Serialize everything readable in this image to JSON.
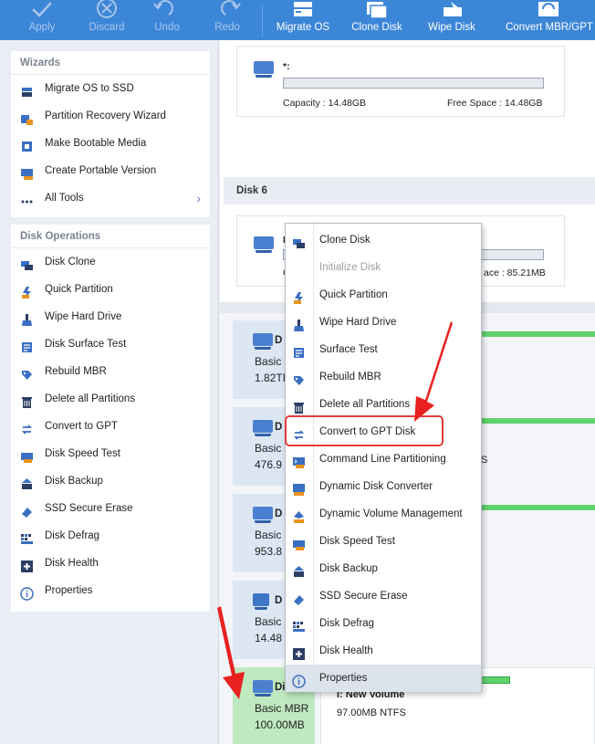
{
  "toolbar": {
    "apply": "Apply",
    "discard": "Discard",
    "undo": "Undo",
    "redo": "Redo",
    "migrate_os": "Migrate OS",
    "clone_disk": "Clone Disk",
    "wipe_disk": "Wipe Disk",
    "convert_mbr_gpt": "Convert MBR/GPT"
  },
  "sidebar": {
    "wizards_title": "Wizards",
    "wizards": [
      {
        "label": "Migrate OS to SSD",
        "icon": "migrate-os-icon"
      },
      {
        "label": "Partition Recovery Wizard",
        "icon": "partition-recovery-icon"
      },
      {
        "label": "Make Bootable Media",
        "icon": "bootable-media-icon"
      },
      {
        "label": "Create Portable Version",
        "icon": "portable-version-icon"
      },
      {
        "label": "All Tools",
        "icon": "all-tools-icon"
      }
    ],
    "disk_ops_title": "Disk Operations",
    "disk_ops": [
      {
        "label": "Disk Clone",
        "icon": "disk-clone-icon"
      },
      {
        "label": "Quick Partition",
        "icon": "quick-partition-icon"
      },
      {
        "label": "Wipe Hard Drive",
        "icon": "wipe-drive-icon"
      },
      {
        "label": "Disk Surface Test",
        "icon": "surface-test-icon"
      },
      {
        "label": "Rebuild MBR",
        "icon": "rebuild-mbr-icon"
      },
      {
        "label": "Delete all Partitions",
        "icon": "delete-partitions-icon"
      },
      {
        "label": "Convert to GPT",
        "icon": "convert-gpt-icon"
      },
      {
        "label": "Disk Speed Test",
        "icon": "speed-test-icon"
      },
      {
        "label": "Disk Backup",
        "icon": "disk-backup-icon"
      },
      {
        "label": "SSD Secure Erase",
        "icon": "secure-erase-icon"
      },
      {
        "label": "Disk Defrag",
        "icon": "defrag-icon"
      },
      {
        "label": "Disk Health",
        "icon": "disk-health-icon"
      },
      {
        "label": "Properties",
        "icon": "properties-icon"
      }
    ]
  },
  "main": {
    "top_partition": {
      "name": "*:",
      "capacity": "Capacity : 14.48GB",
      "free_space": "Free Space : 14.48GB"
    },
    "disk6_header": "Disk 6",
    "disk6_partition": {
      "name_partial": "I",
      "cap_partial": "C",
      "free_partial": "ace : 85.21MB"
    },
    "disks": [
      {
        "name": "D",
        "type": "Basic (",
        "size": "1.82TI"
      },
      {
        "name": "D",
        "type": "Basic (",
        "size": "476.9",
        "extra": "S"
      },
      {
        "name": "D",
        "type": "Basic (",
        "size": "953.8"
      },
      {
        "name": "D",
        "type": "Basic (",
        "size": "14.48"
      },
      {
        "name": "Disk 6",
        "type": "Basic MBR",
        "size": "100.00MB",
        "part_name": "I: New Volume",
        "part_info": "97.00MB NTFS"
      }
    ]
  },
  "context_menu": {
    "items": [
      {
        "label": "Clone Disk",
        "icon": "clone-disk-icon",
        "disabled": false
      },
      {
        "label": "Initialize Disk",
        "icon": "",
        "disabled": true
      },
      {
        "label": "Quick Partition",
        "icon": "quick-partition-icon",
        "disabled": false
      },
      {
        "label": "Wipe Hard Drive",
        "icon": "wipe-drive-icon",
        "disabled": false
      },
      {
        "label": "Surface Test",
        "icon": "surface-test-icon",
        "disabled": false
      },
      {
        "label": "Rebuild MBR",
        "icon": "rebuild-mbr-icon",
        "disabled": false
      },
      {
        "label": "Delete all Partitions",
        "icon": "delete-partitions-icon",
        "disabled": false
      },
      {
        "label": "Convert to GPT Disk",
        "icon": "convert-gpt-icon",
        "disabled": false
      },
      {
        "label": "Command Line Partitioning",
        "icon": "command-line-icon",
        "disabled": false
      },
      {
        "label": "Dynamic Disk Converter",
        "icon": "dynamic-disk-icon",
        "disabled": false
      },
      {
        "label": "Dynamic Volume Management",
        "icon": "dynamic-volume-icon",
        "disabled": false
      },
      {
        "label": "Disk Speed Test",
        "icon": "speed-test-icon",
        "disabled": false
      },
      {
        "label": "Disk Backup",
        "icon": "disk-backup-icon",
        "disabled": false
      },
      {
        "label": "SSD Secure Erase",
        "icon": "secure-erase-icon",
        "disabled": false
      },
      {
        "label": "Disk Defrag",
        "icon": "defrag-icon",
        "disabled": false
      },
      {
        "label": "Disk Health",
        "icon": "disk-health-icon",
        "disabled": false
      },
      {
        "label": "Properties",
        "icon": "properties-icon",
        "disabled": false
      }
    ]
  },
  "colors": {
    "toolbar_blue": "#3c86d8",
    "accent_green": "#5fd36c",
    "selected_disk": "#bfe9bf",
    "highlight_red": "#e43b3b",
    "arrow_red": "#e8221f"
  }
}
